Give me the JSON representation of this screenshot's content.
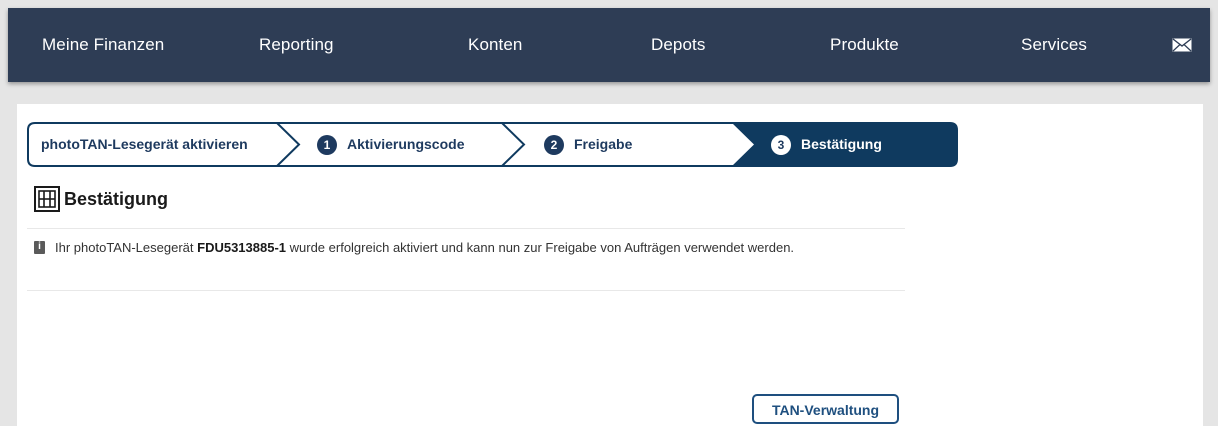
{
  "nav": {
    "items": [
      {
        "label": "Meine Finanzen"
      },
      {
        "label": "Reporting"
      },
      {
        "label": "Konten"
      },
      {
        "label": "Depots"
      },
      {
        "label": "Produkte"
      },
      {
        "label": "Services"
      }
    ],
    "mail_icon": "envelope-icon"
  },
  "wizard": {
    "steps": [
      {
        "label": "photoTAN-Lesegerät aktivieren",
        "number": ""
      },
      {
        "label": "Aktivierungscode",
        "number": "1"
      },
      {
        "label": "Freigabe",
        "number": "2"
      },
      {
        "label": "Bestätigung",
        "number": "3",
        "active": true
      }
    ],
    "active_color": "#0f3a5f",
    "border_color": "#0f3a5f"
  },
  "section": {
    "title": "Bestätigung",
    "logo_icon": "bank-logo-icon"
  },
  "message": {
    "icon": "info-icon",
    "prefix": "Ihr photoTAN-Lesegerät ",
    "device_id": "FDU5313885-1",
    "suffix": " wurde erfolgreich aktiviert und kann nun zur Freigabe von Aufträgen verwendet werden."
  },
  "actions": {
    "tan_management_label": "TAN-Verwaltung"
  },
  "colors": {
    "nav_bg": "#2e3d55",
    "accent": "#0f3a5f",
    "button": "#1e4f7f"
  }
}
